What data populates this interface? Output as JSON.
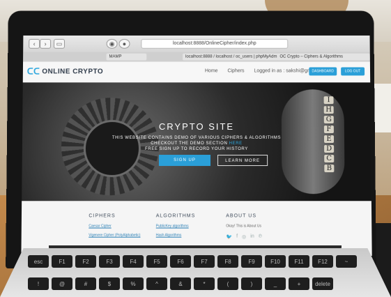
{
  "browser": {
    "url": "localhost:8888/OnlineCipher/index.php",
    "tabs": [
      "MAMP",
      "localhost:8888 / localhost / oc_users | phpMyAdmin 4...",
      "OC Crypto – Ciphers & Algorithms"
    ]
  },
  "site": {
    "logo_text": "ONLINE CRYPTO",
    "nav": [
      "Home",
      "Ciphers"
    ],
    "logged_in": "Logged in as : sakshi@gmail.com",
    "dashboard_label": "DASHBOARD",
    "logout_label": "LOG OUT"
  },
  "hero": {
    "title": "CRYPTO SITE",
    "line1": "THIS WEBSITE CONTAINS DEMO OF VARIOUS CIPHERS & ALGORITHMS",
    "line2_prefix": "CHECKOUT THE DEMO SECTION",
    "line2_link": "HERE",
    "line3": "FREE SIGN UP TO RECORD YOUR HISTORY",
    "signup_label": "SIGN UP",
    "learn_label": "LEARN MORE",
    "letters": [
      "I",
      "H",
      "G",
      "F",
      "E",
      "D",
      "C",
      "B"
    ]
  },
  "footer": {
    "ciphers_title": "CIPHERS",
    "ciphers": [
      "Caesar Cipher",
      "Vigenere Cipher (PolyAlphabetic)"
    ],
    "algorithms_title": "ALGORITHMS",
    "algorithms": [
      "PublicKey algorithms",
      "Hash Algorithms"
    ],
    "about_title": "ABOUT US",
    "about_text": "Okay! This is About Us"
  },
  "keys": [
    "esc",
    "F1",
    "F2",
    "F3",
    "F4",
    "F5",
    "F6",
    "F7",
    "F8",
    "F9",
    "F10",
    "F11",
    "F12",
    "~",
    "!",
    "@",
    "#",
    "$",
    "%",
    "^",
    "&",
    "*",
    "(",
    ")",
    "_",
    "+",
    "delete"
  ],
  "colors": {
    "accent": "#2a9fd8",
    "header_bg": "#f7f7f7",
    "bezel": "#151515"
  }
}
